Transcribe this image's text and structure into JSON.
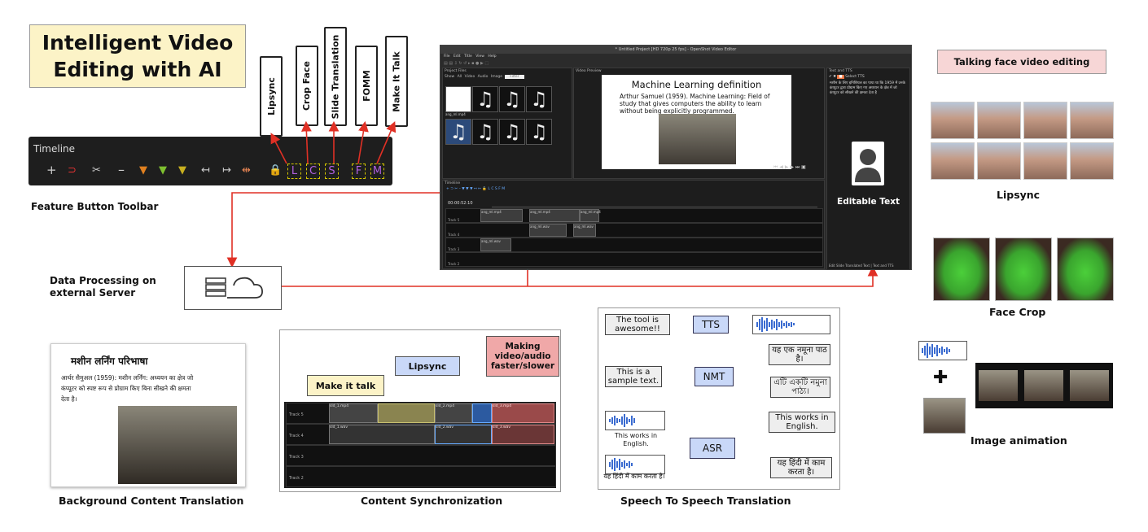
{
  "title": "Intelligent Video Editing with AI",
  "feature_buttons": [
    "Lipsync",
    "Crop Face",
    "Slide Translation",
    "FOMM",
    "Make It Talk"
  ],
  "toolbar": {
    "title": "Timeline",
    "icons": [
      "plus-icon",
      "magnet-icon",
      "scissors-icon",
      "minus-icon",
      "marker-orange-icon",
      "marker-green-icon",
      "marker-yellow-icon",
      "jump-left-icon",
      "jump-right-icon",
      "center-icon",
      "lock-icon"
    ],
    "letters": [
      "L",
      "C",
      "S",
      "F",
      "M"
    ]
  },
  "labels": {
    "feature_toolbar": "Feature Button Toolbar",
    "data_processing": "Data Processing on external Server",
    "talking_face": "Talking face video editing",
    "lipsync": "Lipsync",
    "face_crop": "Face Crop",
    "image_animation": "Image animation",
    "editable_text": "Editable Text",
    "background_translation": "Background Content Translation",
    "content_sync": "Content Synchronization",
    "s2s": "Speech To Speech Translation"
  },
  "editor": {
    "window_title": "* Untitled Project [HD 720p 25 fps] - OpenShot Video Editor",
    "menu": [
      "File",
      "Edit",
      "Title",
      "View",
      "Help"
    ],
    "project_files": "Project Files",
    "file_tabs": [
      "Show All",
      "Video",
      "Audio",
      "Image"
    ],
    "filter_placeholder": "Filter",
    "first_file": "ang_ml.mp4",
    "video_preview": "Video Preview",
    "slide_title": "Machine Learning definition",
    "slide_bullet": "Arthur Samuel (1959). Machine Learning: Field of study that gives computers the ability to learn without being explicitly programmed.",
    "tts_panel": "Text and TTS",
    "tts_select": "Select TTS",
    "timeline": "Timeline",
    "timecode": "00:00:52:10",
    "tracks": [
      "Track 5",
      "Track 4",
      "Track 3",
      "Track 2"
    ],
    "clips_top": [
      "ang_ml.mp4",
      "ang_ml.mp4",
      "ang_ml.mp4"
    ],
    "clips_audio": [
      "ang_ml.wav",
      "ang_ml.wav",
      "ang_ml.wav"
    ],
    "bottom_tabs": [
      "Edit Slide Translated Text",
      "Text and TTS"
    ],
    "hindi_text": "मशीन के लिए इनिशियल का पाया था कि 1959 में उनके कंप्यूटर द्वारा प्रोग्राम किए गए अध्ययन के क्षेत्र में जो कंप्यूटर को सीखने की क्षमता देता है"
  },
  "doc_card": {
    "title": "मशीन लर्निंग परिभाषा",
    "bullet": "आर्थर सैमुअल (1959): मशीन लर्निंग: अध्ययन का क्षेत्र जो कंप्यूटर को स्पष्ट रूप से प्रोग्राम किए बिना सीखने की क्षमता देता है।"
  },
  "sync_card": {
    "make_it_talk": "Make it talk",
    "lipsync": "Lipsync",
    "speed": "Making video/audio faster/slower",
    "tracks": [
      "Track 5",
      "Track 4",
      "Track 3",
      "Track 2"
    ],
    "clips_video": [
      "sld_1.mp4",
      "sld_2.mp4",
      "sld_3.mp4"
    ],
    "clips_audio": [
      "sld_1.wav",
      "sld_2.wav",
      "sld_3.wav"
    ]
  },
  "s2s_card": {
    "tts_input": "The tool is awesome!!",
    "tts": "TTS",
    "nmt_input": "This is a sample text.",
    "nmt": "NMT",
    "nmt_out1": "यह एक नमूना पाठ है।",
    "nmt_out2": "এটি একটি নমুনা পাঠ্য।",
    "asr": "ASR",
    "asr_in1": "This works in English.",
    "asr_in2": "यह हिंदी में काम करता है।",
    "asr_out1": "This works in English.",
    "asr_out2": "यह हिंदी में काम करता है।"
  },
  "colors": {
    "arrow": "#e03025",
    "title_bg": "#fcf3c7",
    "talking_bg": "#f7d6d6",
    "blue_box": "#c9d8f8"
  }
}
